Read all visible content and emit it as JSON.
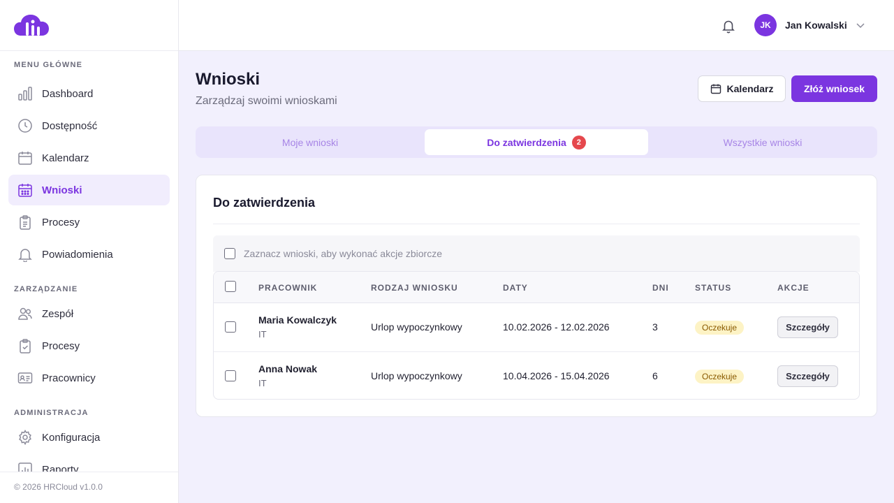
{
  "app": {
    "name": "HRCloud",
    "footer": "© 2026 HRCloud v1.0.0"
  },
  "sidebar": {
    "sections": [
      {
        "title": "MENU GŁÓWNE",
        "items": [
          {
            "label": "Dashboard",
            "icon": "bar-chart-icon"
          },
          {
            "label": "Dostępność",
            "icon": "clock-icon"
          },
          {
            "label": "Kalendarz",
            "icon": "calendar-icon"
          },
          {
            "label": "Wnioski",
            "icon": "calendar-grid-icon",
            "active": true
          },
          {
            "label": "Procesy",
            "icon": "clipboard-icon"
          },
          {
            "label": "Powiadomienia",
            "icon": "bell-icon"
          }
        ]
      },
      {
        "title": "ZARZĄDZANIE",
        "items": [
          {
            "label": "Zespół",
            "icon": "users-icon"
          },
          {
            "label": "Procesy",
            "icon": "clipboard-check-icon"
          },
          {
            "label": "Pracownicy",
            "icon": "id-card-icon"
          }
        ]
      },
      {
        "title": "ADMINISTRACJA",
        "items": [
          {
            "label": "Konfiguracja",
            "icon": "gear-icon"
          },
          {
            "label": "Raporty",
            "icon": "report-chart-icon"
          }
        ]
      }
    ]
  },
  "topbar": {
    "user_initials": "JK",
    "user_name": "Jan Kowalski"
  },
  "header": {
    "title": "Wnioski",
    "subtitle": "Zarządzaj swoimi wnioskami",
    "calendar_button": "Kalendarz",
    "primary_button": "Złóż wniosek"
  },
  "tabs": [
    {
      "label": "Moje wnioski"
    },
    {
      "label": "Do zatwierdzenia",
      "badge": "2",
      "active": true
    },
    {
      "label": "Wszystkie wnioski"
    }
  ],
  "card": {
    "title": "Do zatwierdzenia",
    "bulk_text": "Zaznacz wnioski, aby wykonać akcje zbiorcze",
    "columns": [
      "PRACOWNIK",
      "RODZAJ WNIOSKU",
      "DATY",
      "DNI",
      "STATUS",
      "AKCJE"
    ],
    "rows": [
      {
        "name": "Maria Kowalczyk",
        "dept": "IT",
        "type": "Urlop wypoczynkowy",
        "dates": "10.02.2026 - 12.02.2026",
        "days": "3",
        "status": "Oczekuje",
        "action": "Szczegóły"
      },
      {
        "name": "Anna Nowak",
        "dept": "IT",
        "type": "Urlop wypoczynkowy",
        "dates": "10.04.2026 - 15.04.2026",
        "days": "6",
        "status": "Oczekuje",
        "action": "Szczegóły"
      }
    ]
  },
  "colors": {
    "accent": "#7b35e0",
    "badge": "#e5484d",
    "status_bg": "#fdf3c5"
  }
}
